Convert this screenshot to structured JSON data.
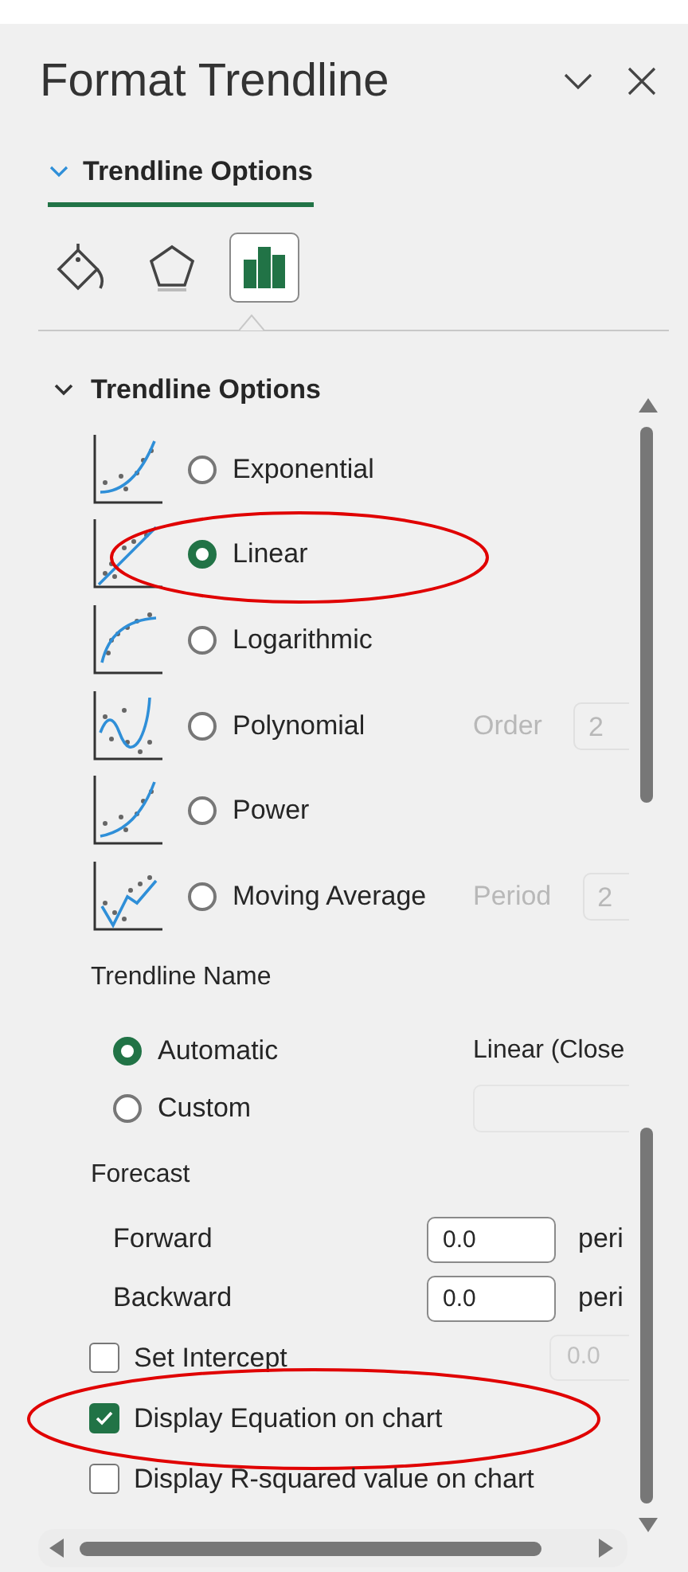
{
  "panel": {
    "title": "Format Trendline"
  },
  "tab": {
    "label": "Trendline Options",
    "expanded": true
  },
  "category_icons": [
    {
      "kind": "fill",
      "selected": false
    },
    {
      "kind": "effects",
      "selected": false
    },
    {
      "kind": "options",
      "selected": true
    }
  ],
  "section": {
    "title": "Trendline Options",
    "expanded": true
  },
  "trend_types": [
    {
      "kind": "exponential",
      "label": "Exponential",
      "selected": false
    },
    {
      "kind": "linear",
      "label": "Linear",
      "selected": true,
      "highlighted": true
    },
    {
      "kind": "logarithmic",
      "label": "Logarithmic",
      "selected": false
    },
    {
      "kind": "polynomial",
      "label": "Polynomial",
      "selected": false,
      "option": {
        "label": "Order",
        "value": "2"
      }
    },
    {
      "kind": "power",
      "label": "Power",
      "selected": false
    },
    {
      "kind": "moving_average",
      "label": "Moving Average",
      "selected": false,
      "option": {
        "label": "Period",
        "value": "2"
      }
    }
  ],
  "trendline_name": {
    "title": "Trendline Name",
    "options": [
      {
        "label": "Automatic",
        "selected": true,
        "value": "Linear (Close"
      },
      {
        "label": "Custom",
        "selected": false
      }
    ]
  },
  "forecast": {
    "title": "Forecast",
    "rows": [
      {
        "label": "Forward",
        "value": "0.0",
        "unit": "peri"
      },
      {
        "label": "Backward",
        "value": "0.0",
        "unit": "peri"
      }
    ]
  },
  "checkboxes": [
    {
      "label": "Set Intercept",
      "checked": false,
      "value": "0.0"
    },
    {
      "label": "Display Equation on chart",
      "checked": true,
      "highlighted": true
    },
    {
      "label": "Display R-squared value on chart",
      "checked": false
    }
  ]
}
